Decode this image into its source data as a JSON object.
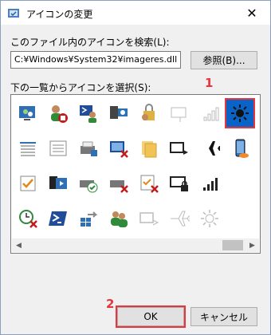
{
  "window": {
    "title": "アイコンの変更",
    "close_glyph": "✕"
  },
  "file_section": {
    "label": "このファイル内のアイコンを検索(L):",
    "path_value": "C:¥Windows¥System32¥imageres.dll",
    "browse_label": "参照(B)..."
  },
  "list_section": {
    "label": "下の一覧からアイコンを選択(S):",
    "selected_icon": "brightness-sun-icon",
    "icons": [
      [
        "network-center-icon",
        "user-blocked-icon",
        "powershell-user-icon",
        "remote-desktop-icon",
        "lock-key-user-icon",
        "sign-outline-icon",
        "signal-outline-icon",
        "brightness-sun-icon"
      ],
      [
        "ruler-icon",
        "form-list-icon",
        "printer-network-icon",
        "screen-blocked-icon",
        "folders-icon",
        "monitor-arrow-icon",
        "airplane-icon",
        "phone-icon"
      ],
      [
        "checkbox-icon",
        "media-display-icon",
        "drive-check-icon",
        "drive-blocked-icon",
        "checklist-blocked-icon",
        "screen-lock-icon",
        "signal-bars-icon",
        ""
      ],
      [
        "clock-blocked-icon",
        "powershell-icon",
        "windows-share-icon",
        "users-icon",
        "monitor-arrow-outline-icon",
        "airplane-outline-icon",
        "sun-outline-icon",
        ""
      ]
    ]
  },
  "annotations": {
    "marker_1": "1",
    "marker_2": "2"
  },
  "buttons": {
    "ok_label": "OK",
    "cancel_label": "キャンセル"
  },
  "colors": {
    "highlight": "#e8343d",
    "selection": "#0a64c8"
  }
}
